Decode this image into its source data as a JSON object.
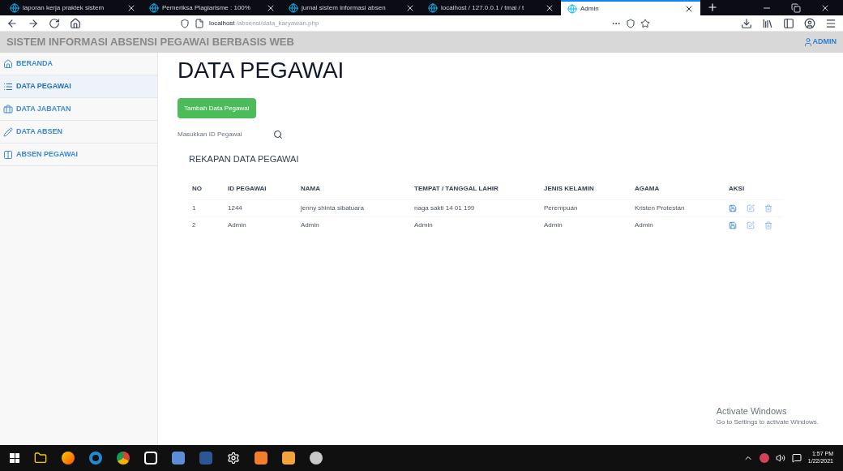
{
  "browser": {
    "tabs": [
      {
        "title": "laporan kerja praktek sistem",
        "selected": false
      },
      {
        "title": "Pemeriksa Plagiarisme : 100%",
        "selected": false
      },
      {
        "title": "jurnal sistem informasi absen",
        "selected": false
      },
      {
        "title": "localhost / 127.0.0.1 / tmai / t",
        "selected": false
      },
      {
        "title": "Admin",
        "selected": true
      }
    ],
    "address": {
      "host": "localhost",
      "path": "/absensi/data_karyawan.php"
    }
  },
  "header": {
    "title": "SISTEM INFORMASI ABSENSI PEGAWAI BERBASIS WEB",
    "user": "ADMIN"
  },
  "sidebar": {
    "items": [
      {
        "label": "BERANDA",
        "kind": "home",
        "selected": false
      },
      {
        "label": "DATA PEGAWAI",
        "kind": "list",
        "selected": true
      },
      {
        "label": "DATA JABATAN",
        "kind": "briefcase",
        "selected": false
      },
      {
        "label": "DATA ABSEN",
        "kind": "pencil",
        "selected": false
      },
      {
        "label": "ABSEN PEGAWAI",
        "kind": "columns",
        "selected": false
      }
    ]
  },
  "main": {
    "title": "DATA PEGAWAI",
    "add_button": "Tambah Data Pegawai",
    "search": {
      "placeholder": "Masukkan ID Pegawai"
    },
    "table_title": "REKAPAN DATA PEGAWAI",
    "table": {
      "columns": [
        "NO",
        "ID PEGAWAI",
        "NAMA",
        "TEMPAT / TANGGAL LAHIR",
        "JENIS KELAMIN",
        "AGAMA",
        "AKSI"
      ],
      "rows": [
        [
          "1",
          "1244",
          "jenny shinta sibatuara",
          "naga sakti 14 01 199",
          "Perempuan",
          "Kristen Protestan"
        ],
        [
          "2",
          "Admin",
          "Admin",
          "Admin",
          "Admin",
          "Admin"
        ]
      ]
    }
  },
  "activation": {
    "title": "Activate Windows",
    "subtitle": "Go to Settings to activate Windows."
  },
  "taskbar": {
    "time": "1:57 PM",
    "date": "1/22/2021"
  }
}
